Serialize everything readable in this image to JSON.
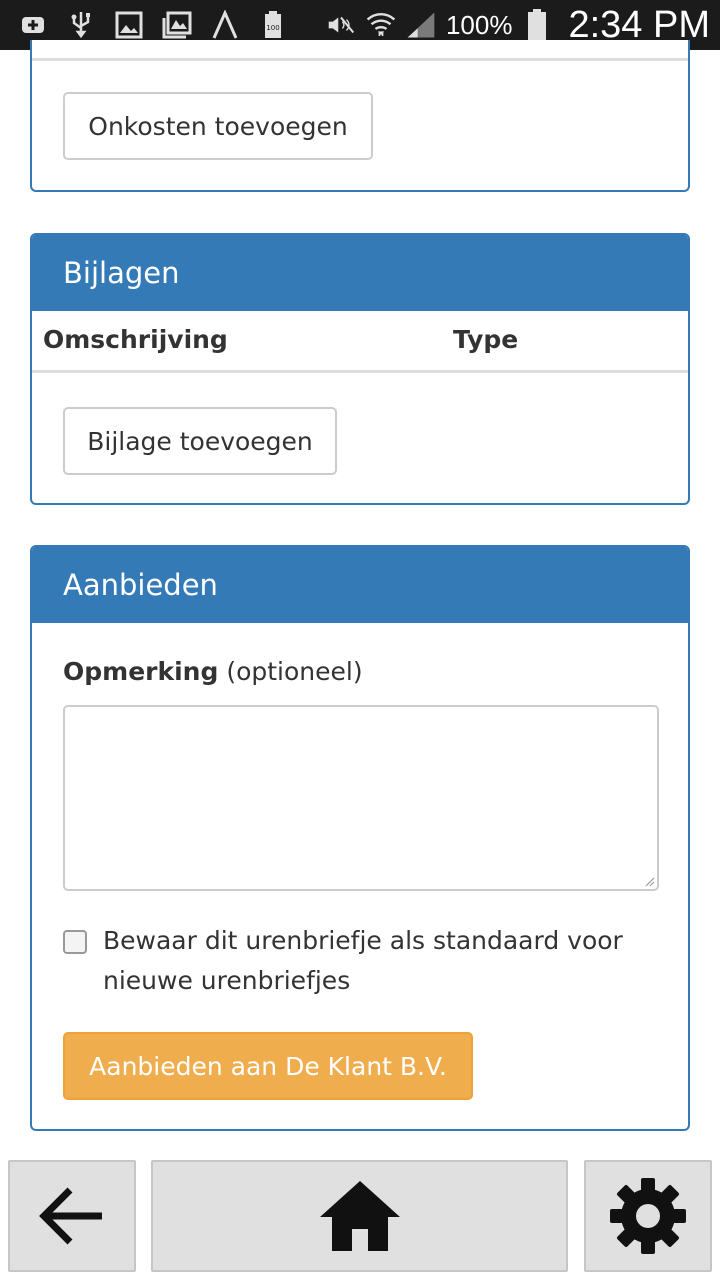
{
  "status_bar": {
    "battery_text": "100%",
    "time": "2:34 PM",
    "icons": [
      "add-box-icon",
      "usb-icon",
      "image-icon",
      "gallery-icon",
      "lambda-icon",
      "battery-100-icon",
      "mute-icon",
      "wifi-icon",
      "signal-icon",
      "battery-icon"
    ]
  },
  "onkosten_panel": {
    "add_button": "Onkosten toevoegen"
  },
  "bijlagen_panel": {
    "title": "Bijlagen",
    "columns": [
      "Omschrijving",
      "Type"
    ],
    "add_button": "Bijlage toevoegen"
  },
  "aanbieden_panel": {
    "title": "Aanbieden",
    "remark_label": "Opmerking",
    "remark_optional": "(optioneel)",
    "remark_value": "",
    "checkbox_label": "Bewaar dit urenbriefje als standaard voor nieuwe urenbriefjes",
    "checkbox_checked": false,
    "submit_button": "Aanbieden aan De Klant B.V."
  },
  "bottom_nav": {
    "items": [
      "back-arrow-icon",
      "home-icon",
      "settings-gear-icon"
    ]
  },
  "colors": {
    "primary": "#337ab7",
    "warning": "#f0ad4e"
  }
}
